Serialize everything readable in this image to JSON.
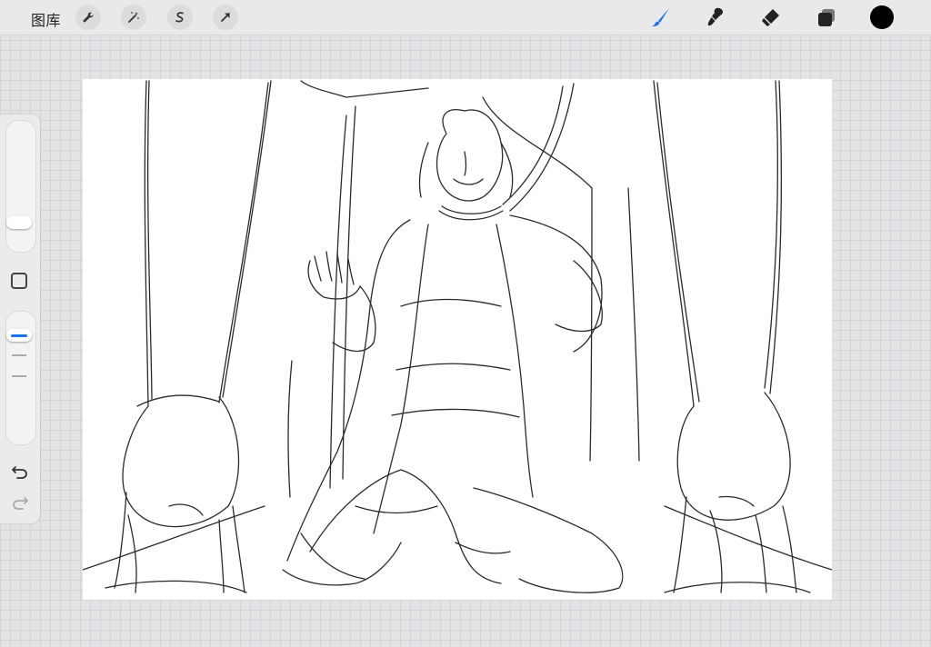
{
  "topbar": {
    "gallery_label": "图库",
    "left_tools": [
      "wrench-icon",
      "magic-wand-icon",
      "selection-icon",
      "transform-arrow-icon"
    ],
    "right_tools": [
      "brush-icon",
      "smudge-icon",
      "eraser-icon",
      "layers-icon"
    ],
    "active_tool": "brush-icon",
    "current_color": "#000000",
    "accent_color": "#1a73e8"
  },
  "sidebar": {
    "brush_size_level": 0.15,
    "opacity_level": 0.9,
    "undo_icon": "undo-icon",
    "redo_icon": "redo-icon"
  },
  "canvas": {
    "background": "#ffffff",
    "content": "pencil-sketch"
  }
}
